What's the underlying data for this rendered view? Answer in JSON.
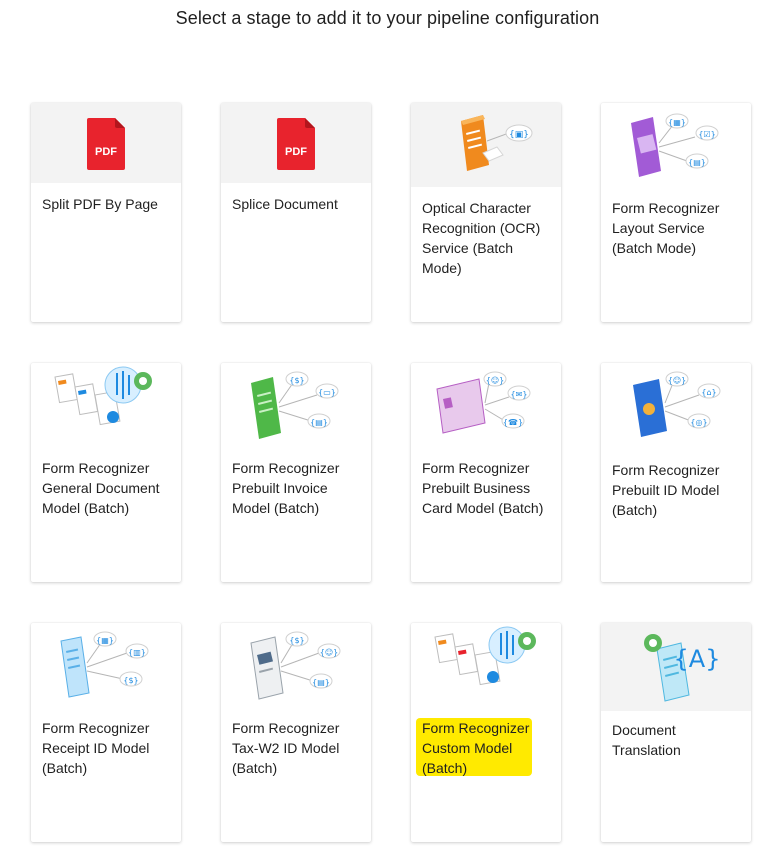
{
  "header": {
    "title": "Select a stage to add it to your pipeline configuration"
  },
  "stages": [
    {
      "label": "Split PDF By Page",
      "icon": "pdf-icon",
      "badge": "PDF"
    },
    {
      "label": "Splice Document",
      "icon": "pdf-icon",
      "badge": "PDF"
    },
    {
      "label": "Optical Character Recognition (OCR) Service (Batch Mode)",
      "icon": "ocr-document-icon"
    },
    {
      "label": "Form Recognizer Layout Service (Batch Mode)",
      "icon": "layout-document-icon"
    },
    {
      "label": "Form Recognizer General Document Model (Batch)",
      "icon": "general-document-model-icon"
    },
    {
      "label": "Form Recognizer Prebuilt Invoice Model (Batch)",
      "icon": "invoice-document-icon"
    },
    {
      "label": "Form Recognizer Prebuilt Business Card Model (Batch)",
      "icon": "business-card-icon"
    },
    {
      "label": "Form Recognizer Prebuilt ID Model (Batch)",
      "icon": "passport-id-icon"
    },
    {
      "label": "Form Recognizer Receipt ID Model (Batch)",
      "icon": "receipt-document-icon"
    },
    {
      "label": "Form Recognizer Tax-W2 ID Model (Batch)",
      "icon": "tax-w2-document-icon"
    },
    {
      "label": "Form Recognizer Custom Model (Batch)",
      "icon": "custom-model-icon"
    },
    {
      "label": "Document Translation",
      "icon": "translation-document-icon"
    }
  ],
  "colors": {
    "highlight": "#ffea00",
    "pdf_red": "#e8232d",
    "accent_blue": "#1e8ae0"
  }
}
